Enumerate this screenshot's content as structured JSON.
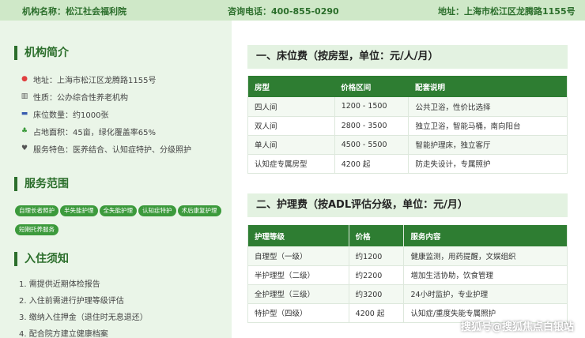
{
  "topbar": {
    "name": "机构名称：松江社会福利院",
    "phone": "咨询电话：400-855-0290",
    "address": "地址：上海市松江区龙腾路1155号"
  },
  "sidebar": {
    "intro_title": "机构简介",
    "info": [
      {
        "icon": "pin-icon",
        "text": "地址：上海市松江区龙腾路1155号"
      },
      {
        "icon": "building-icon",
        "text": "性质：公办综合性养老机构"
      },
      {
        "icon": "bed-icon",
        "text": "床位数量：约1000张"
      },
      {
        "icon": "plant-icon",
        "text": "占地面积：45亩，绿化覆盖率65%"
      },
      {
        "icon": "care-icon",
        "text": "服务特色：医养结合、认知症特护、分级照护"
      }
    ],
    "scope_title": "服务范围",
    "tags": [
      "自理长者照护",
      "半失能护理",
      "全失能护理",
      "认知症特护",
      "术后康复护理",
      "短期托养服务"
    ],
    "notice_title": "入住须知",
    "notices": [
      "1. 需提供近期体检报告",
      "2. 入住前需进行护理等级评估",
      "3. 缴纳入住押金（退住时无息退还）",
      "4. 配合院方建立健康档案"
    ]
  },
  "bed_section": {
    "title": "一、床位费（按房型，单位：元/人/月）",
    "headers": [
      "房型",
      "价格区间",
      "配套说明"
    ],
    "rows": [
      [
        "四人间",
        "1200 - 1500",
        "公共卫浴，性价比选择"
      ],
      [
        "双人间",
        "2800 - 3500",
        "独立卫浴，智能马桶，南向阳台"
      ],
      [
        "单人间",
        "4500 - 5500",
        "智能护理床，独立客厅"
      ],
      [
        "认知症专属房型",
        "4200 起",
        "防走失设计，专属照护"
      ]
    ]
  },
  "care_section": {
    "title": "二、护理费（按ADL评估分级，单位：元/月）",
    "headers": [
      "护理等级",
      "价格",
      "服务内容"
    ],
    "rows": [
      [
        "自理型（一级）",
        "约1200",
        "健康监测，用药提醒，文娱组织"
      ],
      [
        "半护理型（二级）",
        "约2200",
        "增加生活协助，饮食管理"
      ],
      [
        "全护理型（三级）",
        "约3200",
        "24小时监护，专业护理"
      ],
      [
        "特护型（四级）",
        "4200 起",
        "认知症/重度失能专属照护"
      ]
    ]
  },
  "watermark": "搜狐号@搜狐焦点白银站",
  "colors": {
    "accent": "#2e7d32",
    "topbar_bg": "#cfe8c8",
    "sidebar_bg": "#eaf5e8",
    "tag_bg": "#3c9a3c"
  }
}
